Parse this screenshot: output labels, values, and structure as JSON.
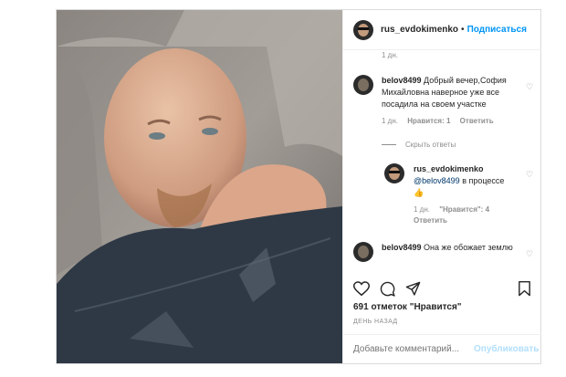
{
  "post": {
    "username": "rus_evdokimenko",
    "separator": "•",
    "follow_label": "Подписаться"
  },
  "comments": {
    "prev_meta": "1 дн.",
    "c1": {
      "author": "belov8499",
      "text": "Добрый вечер,София Михайловна наверное уже все посадила на своем участке",
      "time": "1 дн.",
      "likes": "Нравится: 1",
      "reply": "Ответить"
    },
    "hide_replies": "Скрыть ответы",
    "r1": {
      "author": "rus_evdokimenko",
      "mention": "@belov8499",
      "text": "в процессе",
      "emoji": "👍",
      "time": "1 дн.",
      "likes": "\"Нравится\": 4",
      "reply": "Ответить"
    },
    "c2": {
      "author": "belov8499",
      "text": "Она же обожает землю"
    }
  },
  "footer": {
    "likes_count": "691 отметок \"Нравится\"",
    "date_label": "ДЕНЬ НАЗАД",
    "comment_placeholder": "Добавьте комментарий...",
    "publish_label": "Опубликовать"
  },
  "colors": {
    "accent": "#0095f6",
    "muted": "#8e8e8e",
    "text": "#262626",
    "border": "#dbdbdb"
  },
  "icons": [
    "heart-icon",
    "comment-icon",
    "share-icon",
    "bookmark-icon"
  ]
}
